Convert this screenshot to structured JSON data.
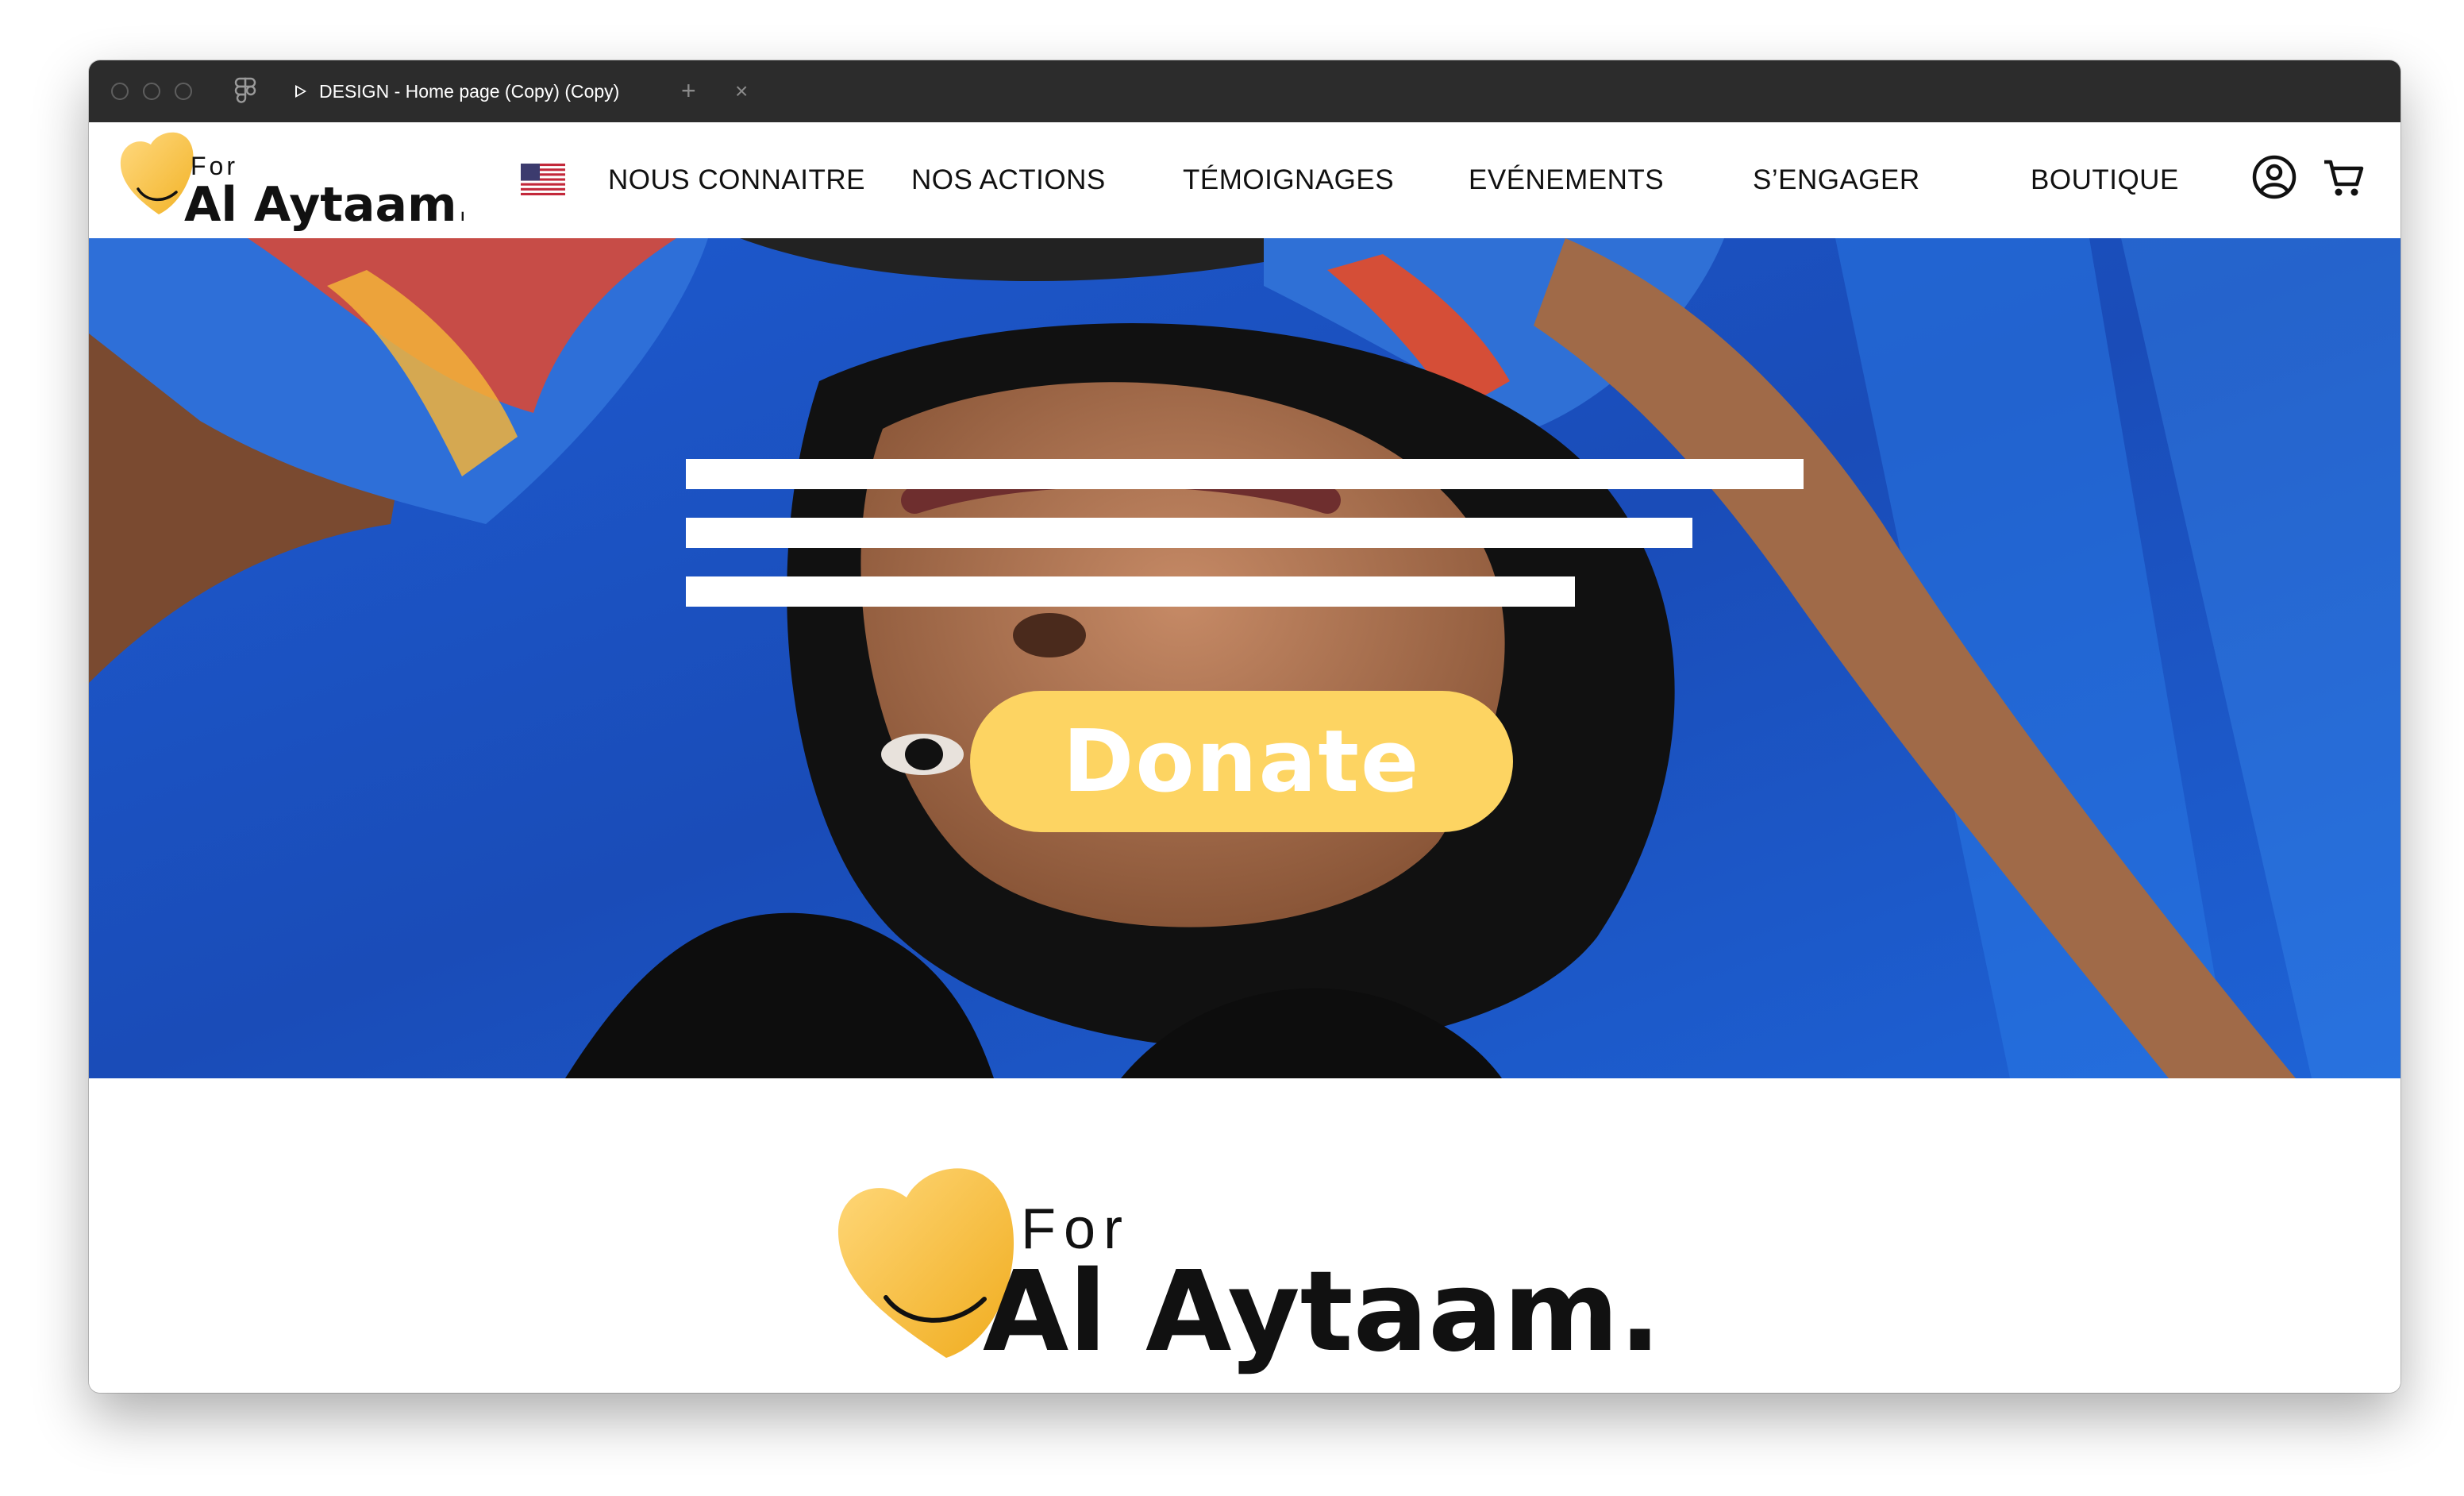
{
  "window": {
    "tab_title": "DESIGN - Home page (Copy) (Copy)",
    "tab_close": "×",
    "new_tab": "+"
  },
  "brand": {
    "prefix": "For",
    "name": "Al Aytaam.",
    "heart_color": "#fdc440",
    "smile_color": "#111111"
  },
  "header": {
    "language_flag": "us-flag-icon",
    "nav": [
      {
        "label": "NOUS CONNAITRE"
      },
      {
        "label": "NOS ACTIONS"
      },
      {
        "label": "TÉMOIGNAGES"
      },
      {
        "label": "EVÉNEMENTS"
      },
      {
        "label": "S’ENGAGER"
      },
      {
        "label": "BOUTIQUE"
      }
    ],
    "icons": [
      "user-account-icon",
      "shopping-cart-icon"
    ]
  },
  "hero": {
    "cta_label": "Donate",
    "cta_color": "#fdd462",
    "background_color": "#1a4fc0",
    "placeholder_bar_color": "#ffffff"
  },
  "footer_logo": {
    "prefix": "For",
    "name": "Al Aytaam."
  }
}
